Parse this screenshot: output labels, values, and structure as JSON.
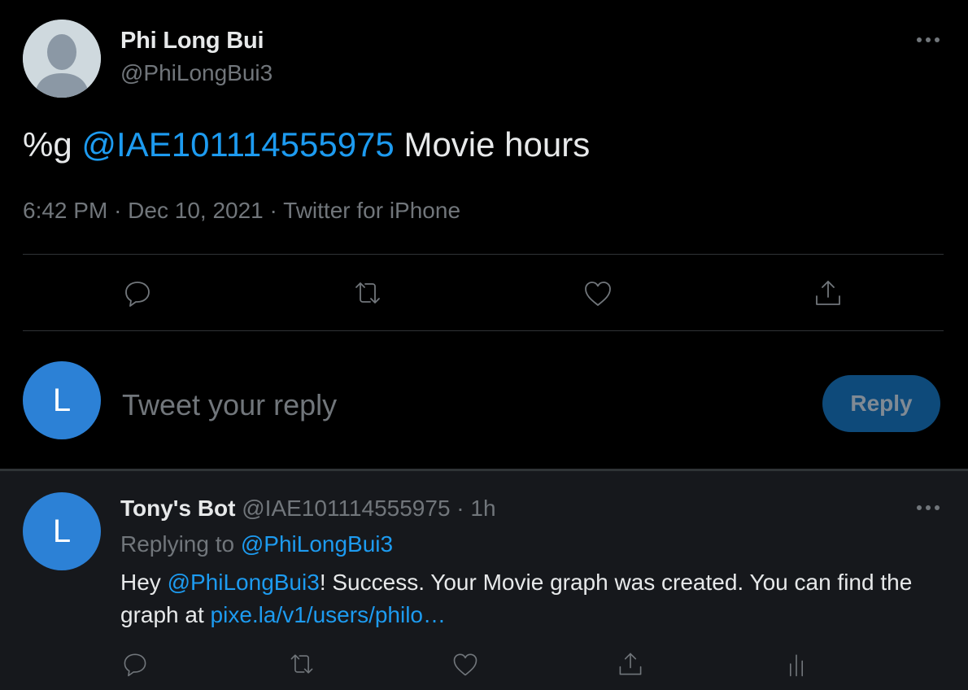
{
  "main_tweet": {
    "author_name": "Phi Long Bui",
    "author_handle": "@PhiLongBui3",
    "text_prefix": "%g",
    "mention": "@IAE101114555975",
    "text_suffix": "Movie hours",
    "time": "6:42 PM",
    "sep1": "·",
    "date": "Dec 10, 2021",
    "sep2": "·",
    "source": "Twitter for iPhone",
    "actions": [
      "reply-icon",
      "retweet-icon",
      "like-icon",
      "share-icon"
    ]
  },
  "composer": {
    "avatar_letter": "L",
    "placeholder": "Tweet your reply",
    "reply_label": "Reply"
  },
  "reply_tweet": {
    "avatar_letter": "L",
    "author_name": "Tony's Bot",
    "author_handle": "@IAE101114555975",
    "dot": "·",
    "time": "1h",
    "replying_label": "Replying to",
    "replying_handle": "@PhiLongBui3",
    "body_prefix": "Hey",
    "body_mention": "@PhiLongBui3",
    "body_text": "! Success. Your Movie graph was created. You can find the graph at",
    "body_link": "pixe.la/v1/users/philo…",
    "actions": [
      "reply-icon",
      "retweet-icon",
      "like-icon",
      "share-icon",
      "analytics-icon"
    ]
  },
  "colors": {
    "background": "#000000",
    "reply_background": "#16181c",
    "text": "#e7e9ea",
    "muted": "#71767b",
    "accent": "#1d9bf0",
    "avatar_blue": "#2c81d6",
    "reply_button_bg": "#0e4a7a",
    "divider": "#2f3336"
  }
}
